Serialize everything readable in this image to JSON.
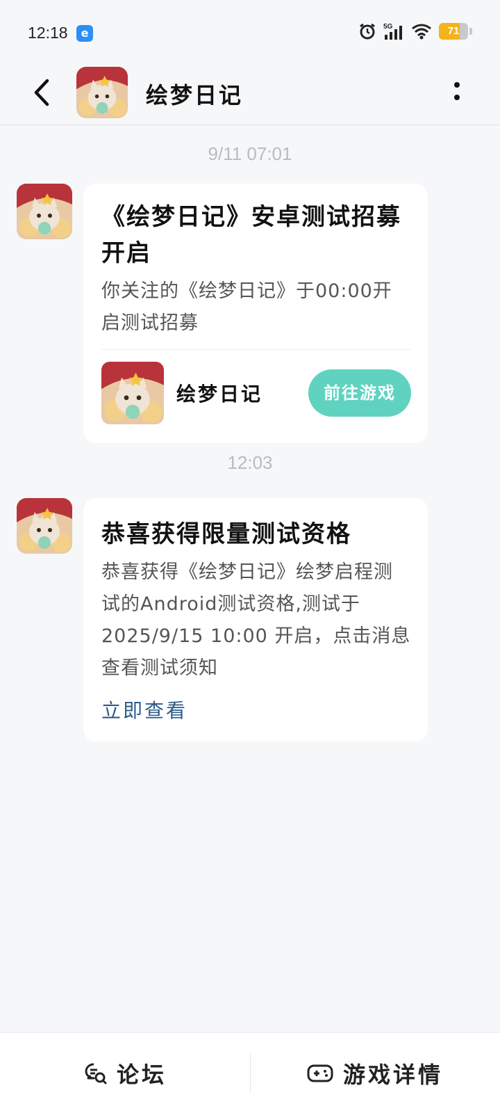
{
  "status_bar": {
    "time": "12:18",
    "battery": "71",
    "battery_level": 0.71,
    "network": "5G"
  },
  "header": {
    "title": "绘梦日记"
  },
  "messages": [
    {
      "timestamp": "9/11  07:01",
      "title": "《绘梦日记》安卓测试招募开启",
      "body": "你关注的《绘梦日记》于00:00开启测试招募",
      "game_name": "绘梦日记",
      "button_label": "前往游戏"
    },
    {
      "timestamp": "12:03",
      "title": "恭喜获得限量测试资格",
      "body": "恭喜获得《绘梦日记》绘梦启程测试的Android测试资格,测试于2025/9/15 10:00 开启，点击消息查看测试须知",
      "link_label": "立即查看"
    }
  ],
  "bottom_bar": {
    "forum_label": "论坛",
    "details_label": "游戏详情"
  },
  "colors": {
    "accent": "#5fd3c0",
    "link": "#2e5b8a",
    "background": "#f6f7f9",
    "battery": "#f3b31b"
  }
}
